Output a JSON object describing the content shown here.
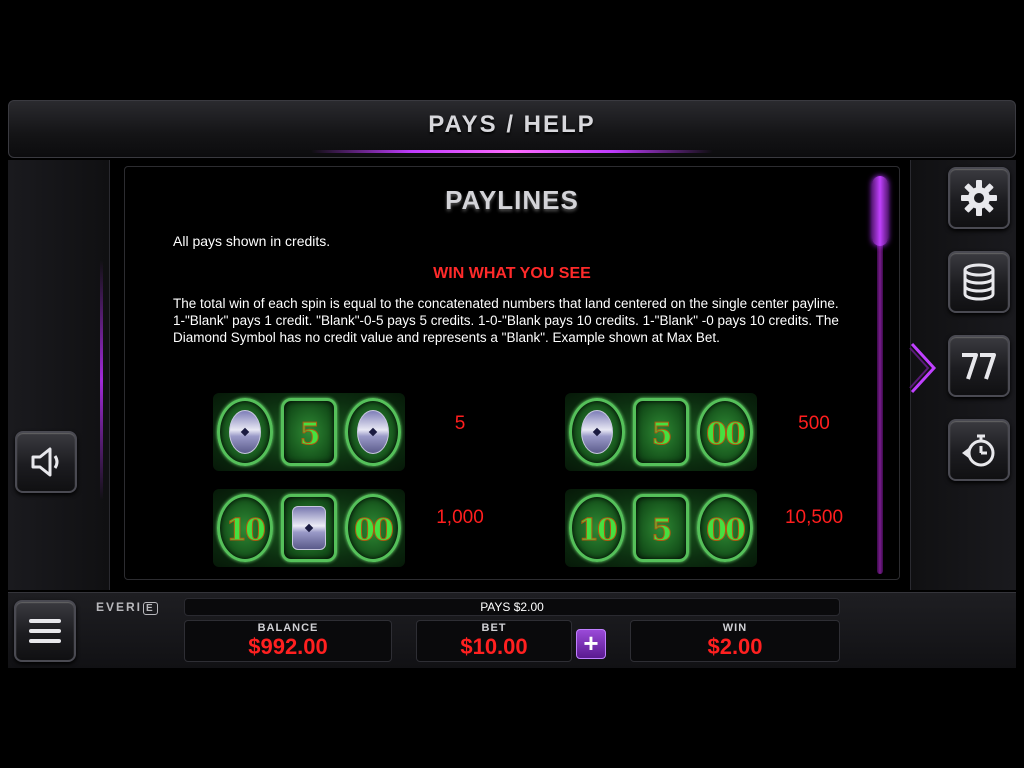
{
  "header": {
    "title": "PAYS / HELP"
  },
  "panel": {
    "title": "PAYLINES",
    "note": "All pays shown in credits.",
    "subtitle": "WIN WHAT YOU SEE",
    "description": "The total win of each  spin is equal to the concatenated numbers that land centered on the single center payline. 1-\"Blank\" pays 1 credit. \"Blank\"-0-5 pays 5 credits. 1-0-\"Blank pays 10 credits. 1-\"Blank\" -0 pays 10 credits. The Diamond Symbol has no credit value and represents a \"Blank\". Example shown at Max Bet.",
    "combos": [
      {
        "reels": [
          "blank",
          "5",
          "blank"
        ],
        "pay": "5"
      },
      {
        "reels": [
          "blank",
          "5",
          "00"
        ],
        "pay": "500"
      },
      {
        "reels": [
          "10",
          "blank",
          "00"
        ],
        "pay": "1,000"
      },
      {
        "reels": [
          "10",
          "5",
          "00"
        ],
        "pay": "10,500"
      }
    ],
    "scroll_position": 0
  },
  "side_buttons": {
    "right": [
      "gear-icon",
      "coin-stack-icon",
      "sevens-icon",
      "stopwatch-back-icon"
    ],
    "left": [
      "speaker-icon"
    ],
    "menu": "hamburger-icon"
  },
  "bottom": {
    "brand": "EVERI",
    "brand_box": "E",
    "pays_strip": "PAYS $2.00",
    "balance": {
      "label": "BALANCE",
      "value": "$992.00"
    },
    "bet": {
      "label": "BET",
      "value": "$10.00",
      "plus": "+"
    },
    "win": {
      "label": "WIN",
      "value": "$2.00"
    }
  },
  "colors": {
    "accent_purple": "#c040ff",
    "pay_red": "#ff1e1e",
    "reel_green": "#46e040"
  }
}
